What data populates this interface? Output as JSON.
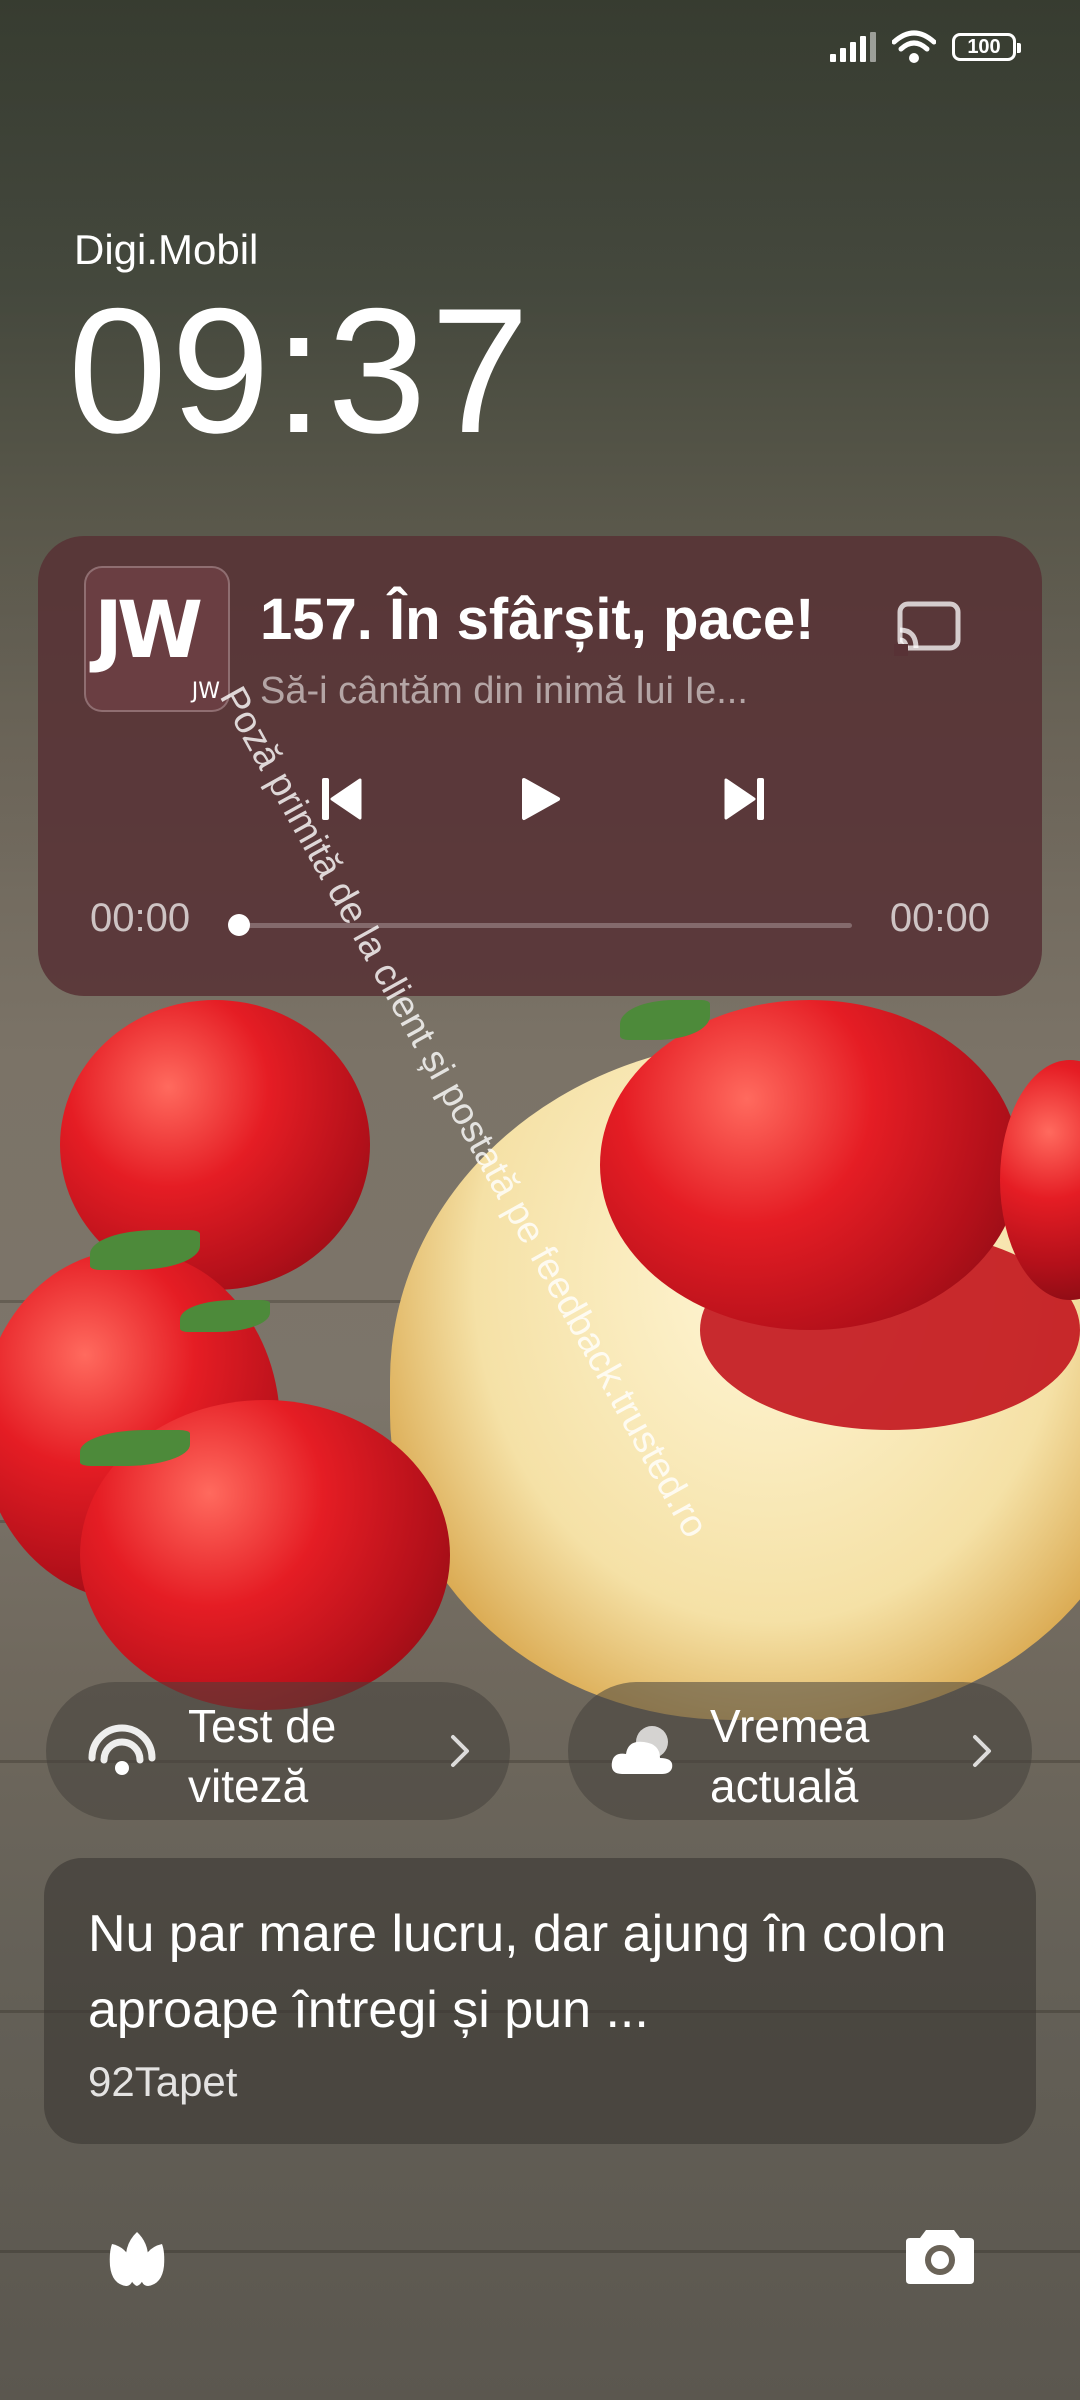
{
  "status_bar": {
    "battery": "100",
    "icons": [
      "signal-icon",
      "wifi-icon",
      "battery-icon"
    ]
  },
  "lock": {
    "carrier": "Digi.Mobil",
    "time": "09:37"
  },
  "media": {
    "app_logo_text": "JW",
    "app_logo_subtext": "JW",
    "title": "157. În sfârșit, pace!",
    "subtitle": "Să-i cântăm din inimă lui Ie...",
    "elapsed": "00:00",
    "duration": "00:00",
    "progress": 0,
    "controls": [
      "previous-icon",
      "play-icon",
      "next-icon",
      "cast-icon"
    ]
  },
  "watermark": "Poză primită de la client și postată pe feedback.trusted.ro",
  "shortcuts": [
    {
      "line1": "Test de",
      "line2": "viteză",
      "icon": "speed-test-icon"
    },
    {
      "line1": "Vremea",
      "line2": "actuală",
      "icon": "cloud-icon"
    }
  ],
  "notification": {
    "text": "Nu par mare lucru, dar ajung în colon aproape întregi și pun ...",
    "app": "92Tapet"
  },
  "bottom": {
    "left_icon": "tulip-icon",
    "right_icon": "camera-icon"
  },
  "colors": {
    "media_card": "#58323680",
    "strawberry": "#e51d24"
  }
}
